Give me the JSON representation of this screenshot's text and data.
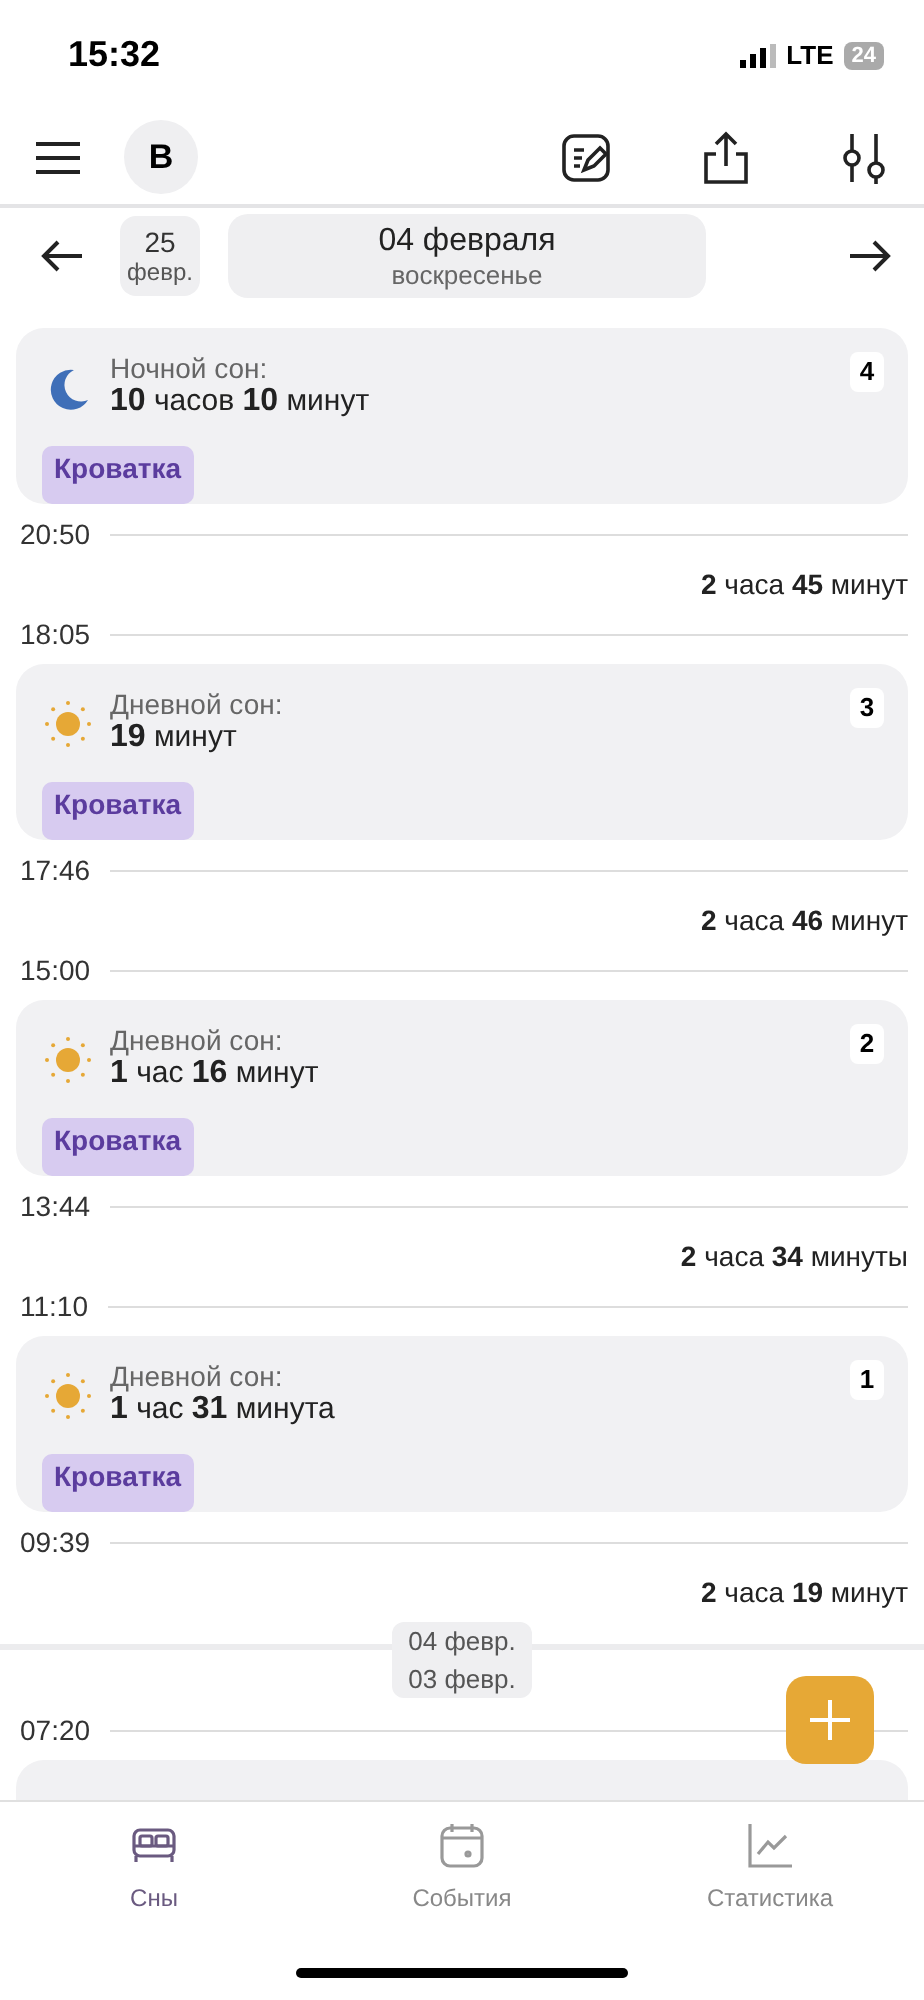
{
  "status_bar": {
    "time": "15:32",
    "network": "LTE",
    "battery": "24"
  },
  "header": {
    "avatar": "B"
  },
  "date_nav": {
    "prev_day": "25",
    "prev_month": "февр.",
    "date": "04 февраля",
    "weekday": "воскресенье"
  },
  "timeline": [
    {
      "kind": "card",
      "night": true,
      "label": "Ночной сон:",
      "duration": "**10** часов **10** минут",
      "tag": "Кроватка",
      "number": "4"
    },
    {
      "kind": "time",
      "text": "20:50"
    },
    {
      "kind": "gap",
      "text": "**2** часа **45** минут"
    },
    {
      "kind": "time",
      "text": "18:05"
    },
    {
      "kind": "card",
      "night": false,
      "label": "Дневной сон:",
      "duration": "**19** минут",
      "tag": "Кроватка",
      "number": "3"
    },
    {
      "kind": "time",
      "text": "17:46"
    },
    {
      "kind": "gap",
      "text": "**2** часа **46** минут"
    },
    {
      "kind": "time",
      "text": "15:00"
    },
    {
      "kind": "card",
      "night": false,
      "label": "Дневной сон:",
      "duration": "**1** час **16** минут",
      "tag": "Кроватка",
      "number": "2"
    },
    {
      "kind": "time",
      "text": "13:44"
    },
    {
      "kind": "gap",
      "text": "**2** часа **34** минуты"
    },
    {
      "kind": "time",
      "text": "11:10"
    },
    {
      "kind": "card",
      "night": false,
      "label": "Дневной сон:",
      "duration": "**1** час **31** минута",
      "tag": "Кроватка",
      "number": "1"
    },
    {
      "kind": "time",
      "text": "09:39"
    },
    {
      "kind": "gap",
      "text": "**2** часа **19** минут"
    },
    {
      "kind": "day",
      "upper": "04 февр.",
      "lower": "03 февр."
    },
    {
      "kind": "time",
      "text": "07:20"
    },
    {
      "kind": "partial"
    }
  ],
  "tabs": [
    {
      "label": "Сны",
      "selected": true
    },
    {
      "label": "События",
      "selected": false
    },
    {
      "label": "Статистика",
      "selected": false
    }
  ]
}
